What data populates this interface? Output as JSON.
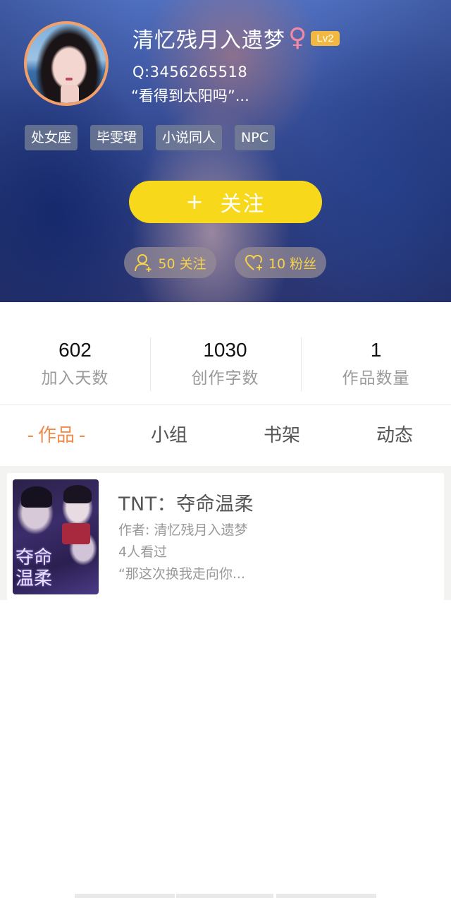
{
  "profile": {
    "username": "清忆残月入遗梦",
    "gender_symbol": "♀",
    "level": "Lv2",
    "qq": "Q:3456265518",
    "signature": "“看得到太阳吗”...",
    "tags": [
      "处女座",
      "毕雯珺",
      "小说同人",
      "NPC"
    ],
    "follow_button": "关注",
    "follow_plus": "+",
    "following_label": "50 关注",
    "fans_label": "10 粉丝"
  },
  "stats": [
    {
      "value": "602",
      "label": "加入天数"
    },
    {
      "value": "1030",
      "label": "创作字数"
    },
    {
      "value": "1",
      "label": "作品数量"
    }
  ],
  "tabs": {
    "works": "作品",
    "active_dash": "-",
    "groups": "小组",
    "bookshelf": "书架",
    "activity": "动态"
  },
  "work": {
    "title": "TNT：夺命温柔",
    "author": "作者: 清忆残月入遗梦",
    "views": "4人看过",
    "snippet": "“那这次换我走向你...",
    "cover_text": "夺命\n温柔"
  },
  "colors": {
    "accent_orange": "#f08a4b",
    "follow_yellow": "#f7d81a",
    "level_badge": "#f3b840",
    "female_pink": "#f08aa6"
  }
}
